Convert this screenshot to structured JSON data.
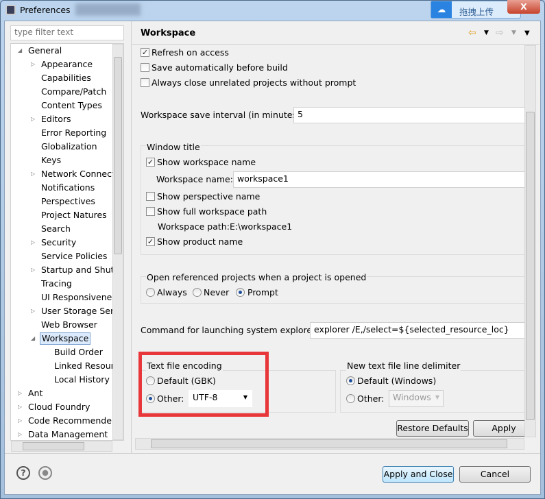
{
  "window": {
    "title": "Preferences",
    "upload_label": "拖拽上传",
    "close_label": "X"
  },
  "sidebar": {
    "filter_placeholder": "type filter text",
    "items": [
      {
        "label": "General",
        "level": 0,
        "expanded": true
      },
      {
        "label": "Appearance",
        "level": 1,
        "expandable": true
      },
      {
        "label": "Capabilities",
        "level": 1
      },
      {
        "label": "Compare/Patch",
        "level": 1
      },
      {
        "label": "Content Types",
        "level": 1
      },
      {
        "label": "Editors",
        "level": 1,
        "expandable": true
      },
      {
        "label": "Error Reporting",
        "level": 1
      },
      {
        "label": "Globalization",
        "level": 1
      },
      {
        "label": "Keys",
        "level": 1
      },
      {
        "label": "Network Connecti",
        "level": 1,
        "expandable": true
      },
      {
        "label": "Notifications",
        "level": 1
      },
      {
        "label": "Perspectives",
        "level": 1
      },
      {
        "label": "Project Natures",
        "level": 1
      },
      {
        "label": "Search",
        "level": 1
      },
      {
        "label": "Security",
        "level": 1,
        "expandable": true
      },
      {
        "label": "Service Policies",
        "level": 1
      },
      {
        "label": "Startup and Shutd",
        "level": 1,
        "expandable": true
      },
      {
        "label": "Tracing",
        "level": 1
      },
      {
        "label": "UI Responsiveness",
        "level": 1
      },
      {
        "label": "User Storage Serv",
        "level": 1,
        "expandable": true
      },
      {
        "label": "Web Browser",
        "level": 1
      },
      {
        "label": "Workspace",
        "level": 1,
        "expanded": true,
        "selected": true
      },
      {
        "label": "Build Order",
        "level": 2
      },
      {
        "label": "Linked Resourc",
        "level": 2
      },
      {
        "label": "Local History",
        "level": 2
      },
      {
        "label": "Ant",
        "level": 0,
        "expandable": true
      },
      {
        "label": "Cloud Foundry",
        "level": 0,
        "expandable": true
      },
      {
        "label": "Code Recommenders",
        "level": 0,
        "expandable": true
      },
      {
        "label": "Data Management",
        "level": 0,
        "expandable": true
      }
    ]
  },
  "page": {
    "title": "Workspace",
    "refresh_on_access": {
      "label": "Refresh on access",
      "checked": true
    },
    "save_auto": {
      "label": "Save automatically before build",
      "checked": false
    },
    "always_close": {
      "label": "Always close unrelated projects without prompt",
      "checked": false
    },
    "save_interval": {
      "label": "Workspace save interval (in minutes):",
      "value": "5"
    },
    "window_title": {
      "label": "Window title",
      "show_ws_name": {
        "label": "Show workspace name",
        "checked": true
      },
      "ws_name": {
        "label": "Workspace name:",
        "value": "workspace1"
      },
      "show_perspective": {
        "label": "Show perspective name",
        "checked": false
      },
      "show_full_path": {
        "label": "Show full workspace path",
        "checked": false
      },
      "ws_path": {
        "label": "Workspace path:",
        "value": "E:\\workspace1"
      },
      "show_product": {
        "label": "Show product name",
        "checked": true
      }
    },
    "open_ref": {
      "label": "Open referenced projects when a project is opened",
      "options": [
        "Always",
        "Never",
        "Prompt"
      ],
      "selected": "Prompt"
    },
    "explorer": {
      "label": "Command for launching system explorer:",
      "value": "explorer /E,/select=${selected_resource_loc}"
    },
    "encoding": {
      "label": "Text file encoding",
      "default_label": "Default (GBK)",
      "other_label": "Other:",
      "selected": "Other",
      "value": "UTF-8"
    },
    "delimiter": {
      "label": "New text file line delimiter",
      "default_label": "Default (Windows)",
      "other_label": "Other:",
      "selected": "Default",
      "value": "Windows"
    },
    "restore_defaults": "Restore Defaults",
    "apply": "Apply"
  },
  "footer": {
    "apply_close": "Apply and Close",
    "cancel": "Cancel",
    "help_icon": "?"
  },
  "colors": {
    "highlight": "#e8373a",
    "accent": "#1e4f9c"
  }
}
